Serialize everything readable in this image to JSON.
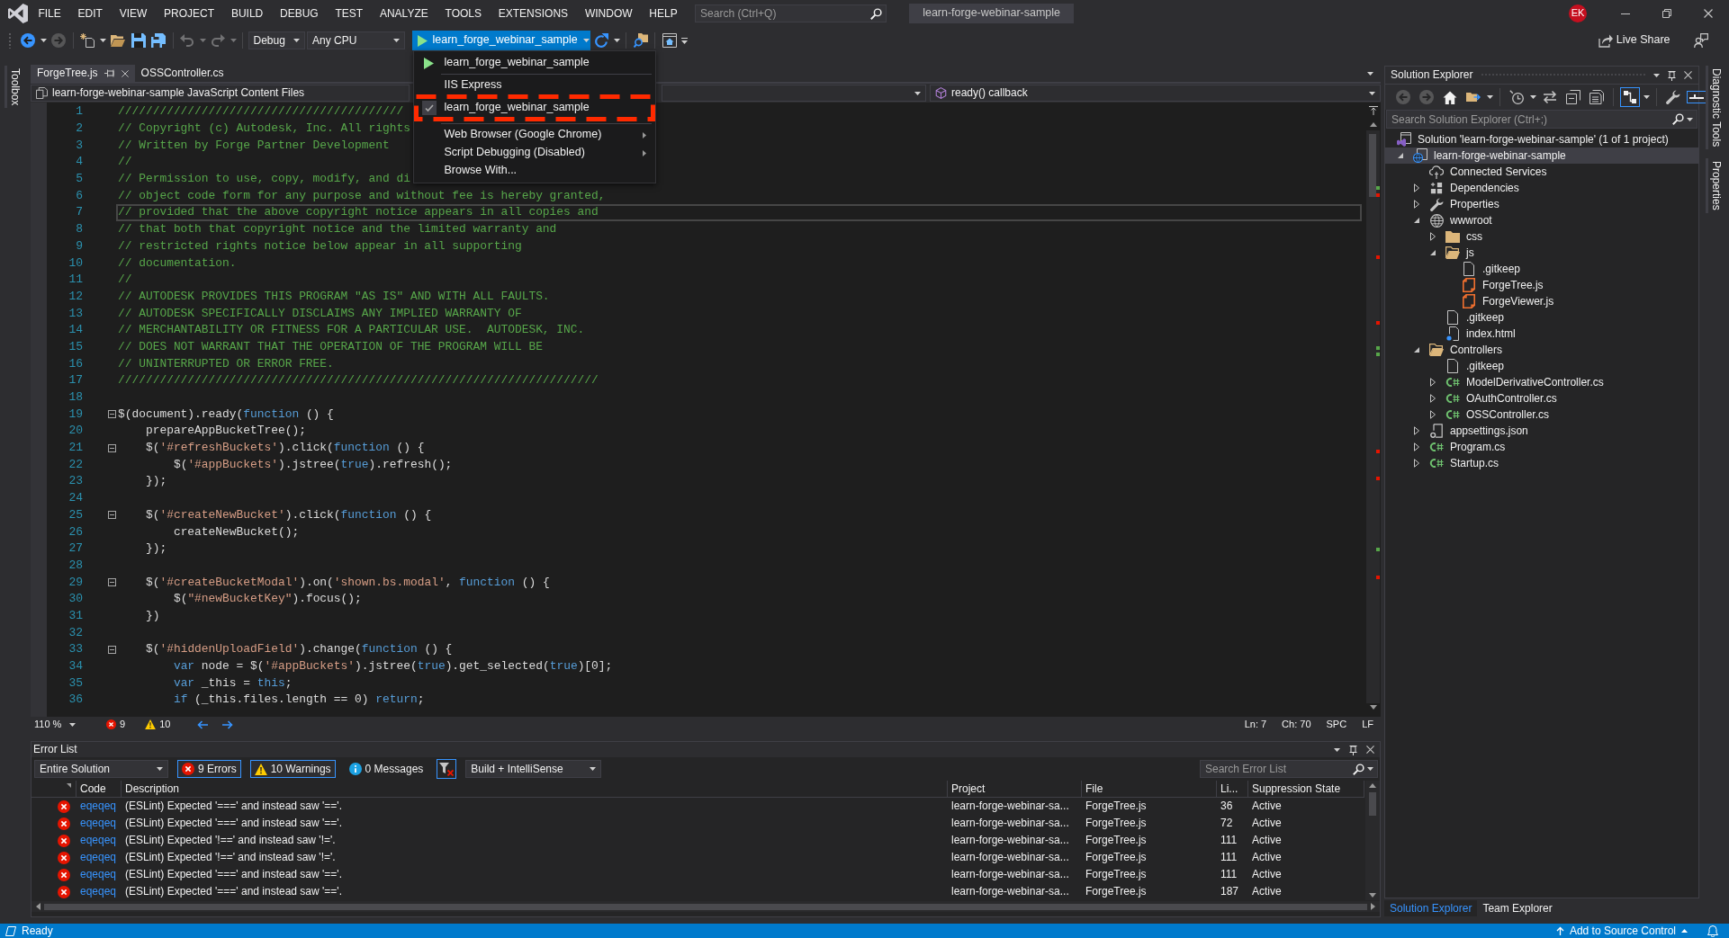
{
  "title_bar": {
    "menu": [
      "FILE",
      "EDIT",
      "VIEW",
      "PROJECT",
      "BUILD",
      "DEBUG",
      "TEST",
      "ANALYZE",
      "TOOLS",
      "EXTENSIONS",
      "WINDOW",
      "HELP"
    ],
    "search": {
      "placeholder": "Search (Ctrl+Q)"
    },
    "solution_name": "learn-forge-webinar-sample",
    "avatar": "EK"
  },
  "toolbar": {
    "items": [
      {
        "kind": "back",
        "disabled": false
      },
      {
        "kind": "caret",
        "disabled": false
      },
      {
        "kind": "forward",
        "disabled": true
      },
      {
        "kind": "separator"
      },
      {
        "kind": "new-project",
        "disabled": false
      },
      {
        "kind": "caret",
        "disabled": false
      },
      {
        "kind": "open",
        "disabled": false
      },
      {
        "kind": "save",
        "disabled": false
      },
      {
        "kind": "save-all",
        "disabled": false
      },
      {
        "kind": "separator"
      },
      {
        "kind": "undo",
        "disabled": true
      },
      {
        "kind": "caret",
        "disabled": true
      },
      {
        "kind": "redo",
        "disabled": true
      },
      {
        "kind": "caret",
        "disabled": true
      },
      {
        "kind": "separator"
      },
      {
        "kind": "combo",
        "value": "Debug"
      },
      {
        "kind": "combo",
        "value": "Any CPU"
      },
      {
        "kind": "run",
        "label": "learn_forge_webinar_sample",
        "expanded": true,
        "menu": [
          {
            "items": [
              {
                "kind": "run",
                "label": "learn_forge_webinar_sample",
                "checked": false,
                "annotated": false
              }
            ]
          },
          {
            "items": [
              {
                "kind": "option",
                "label": "IIS Express",
                "checked": false,
                "annotated": false
              },
              {
                "kind": "option",
                "label": "learn_forge_webinar_sample",
                "checked": true,
                "annotated": true
              }
            ]
          },
          {
            "items": [
              {
                "kind": "submenu",
                "label": "Web Browser (Google Chrome)",
                "checked": false,
                "annotated": false
              },
              {
                "kind": "submenu",
                "label": "Script Debugging (Disabled)",
                "checked": false,
                "annotated": false
              },
              {
                "kind": "command",
                "label": "Browse With...",
                "checked": false,
                "annotated": false
              }
            ]
          }
        ]
      },
      {
        "kind": "refresh",
        "disabled": false
      },
      {
        "kind": "caret",
        "disabled": false
      },
      {
        "kind": "separator"
      },
      {
        "kind": "find",
        "disabled": false
      },
      {
        "kind": "separator"
      },
      {
        "kind": "browser-link",
        "disabled": false
      },
      {
        "kind": "overflow",
        "disabled": false
      }
    ],
    "live_share": "Live Share"
  },
  "toolbox": "Toolbox",
  "editor": {
    "tabs": [
      {
        "label": "ForgeTree.js",
        "selected": true
      },
      {
        "label": "OSSController.cs",
        "selected": false
      }
    ],
    "navigation": {
      "project": "learn-forge-webinar-sample JavaScript Content Files",
      "member": "ready() callback"
    },
    "lines": [
      {
        "number": "1",
        "fold": false,
        "current": false,
        "tokens": [
          {
            "kind": "comment",
            "text": "/////////////////////////////////////////"
          }
        ]
      },
      {
        "number": "2",
        "fold": false,
        "current": false,
        "tokens": [
          {
            "kind": "comment",
            "text": "// Copyright (c) Autodesk, Inc. All rights"
          }
        ]
      },
      {
        "number": "3",
        "fold": false,
        "current": false,
        "tokens": [
          {
            "kind": "comment",
            "text": "// Written by Forge Partner Development"
          }
        ]
      },
      {
        "number": "4",
        "fold": false,
        "current": false,
        "tokens": [
          {
            "kind": "comment",
            "text": "//"
          }
        ]
      },
      {
        "number": "5",
        "fold": false,
        "current": false,
        "tokens": [
          {
            "kind": "comment",
            "text": "// Permission to use, copy, modify, and di"
          }
        ]
      },
      {
        "number": "6",
        "fold": false,
        "current": false,
        "tokens": [
          {
            "kind": "comment",
            "text": "// object code form for any purpose and without fee is hereby granted,"
          }
        ]
      },
      {
        "number": "7",
        "fold": false,
        "current": true,
        "tokens": [
          {
            "kind": "comment",
            "text": "// provided that the above copyright notice appears in all copies and"
          }
        ]
      },
      {
        "number": "8",
        "fold": false,
        "current": false,
        "tokens": [
          {
            "kind": "comment",
            "text": "// that both that copyright notice and the limited warranty and"
          }
        ]
      },
      {
        "number": "9",
        "fold": false,
        "current": false,
        "tokens": [
          {
            "kind": "comment",
            "text": "// restricted rights notice below appear in all supporting"
          }
        ]
      },
      {
        "number": "10",
        "fold": false,
        "current": false,
        "tokens": [
          {
            "kind": "comment",
            "text": "// documentation."
          }
        ]
      },
      {
        "number": "11",
        "fold": false,
        "current": false,
        "tokens": [
          {
            "kind": "comment",
            "text": "//"
          }
        ]
      },
      {
        "number": "12",
        "fold": false,
        "current": false,
        "tokens": [
          {
            "kind": "comment",
            "text": "// AUTODESK PROVIDES THIS PROGRAM \"AS IS\" AND WITH ALL FAULTS."
          }
        ]
      },
      {
        "number": "13",
        "fold": false,
        "current": false,
        "tokens": [
          {
            "kind": "comment",
            "text": "// AUTODESK SPECIFICALLY DISCLAIMS ANY IMPLIED WARRANTY OF"
          }
        ]
      },
      {
        "number": "14",
        "fold": false,
        "current": false,
        "tokens": [
          {
            "kind": "comment",
            "text": "// MERCHANTABILITY OR FITNESS FOR A PARTICULAR USE.  AUTODESK, INC."
          }
        ]
      },
      {
        "number": "15",
        "fold": false,
        "current": false,
        "tokens": [
          {
            "kind": "comment",
            "text": "// DOES NOT WARRANT THAT THE OPERATION OF THE PROGRAM WILL BE"
          }
        ]
      },
      {
        "number": "16",
        "fold": false,
        "current": false,
        "tokens": [
          {
            "kind": "comment",
            "text": "// UNINTERRUPTED OR ERROR FREE."
          }
        ]
      },
      {
        "number": "17",
        "fold": false,
        "current": false,
        "tokens": [
          {
            "kind": "comment",
            "text": "/////////////////////////////////////////////////////////////////////"
          }
        ]
      },
      {
        "number": "18",
        "fold": false,
        "current": false
      },
      {
        "number": "19",
        "fold": true,
        "current": false,
        "tokens": [
          {
            "kind": "plain",
            "text": "$(document).ready("
          },
          {
            "kind": "keyword",
            "text": "function"
          },
          {
            "kind": "plain",
            "text": " () {"
          }
        ]
      },
      {
        "number": "20",
        "fold": false,
        "current": false,
        "tokens": [
          {
            "kind": "plain",
            "text": "    prepareAppBucketTree();"
          }
        ]
      },
      {
        "number": "21",
        "fold": true,
        "current": false,
        "tokens": [
          {
            "kind": "plain",
            "text": "    $("
          },
          {
            "kind": "string",
            "text": "'#refreshBuckets'"
          },
          {
            "kind": "plain",
            "text": ").click("
          },
          {
            "kind": "keyword",
            "text": "function"
          },
          {
            "kind": "plain",
            "text": " () {"
          }
        ]
      },
      {
        "number": "22",
        "fold": false,
        "current": false,
        "tokens": [
          {
            "kind": "plain",
            "text": "        $("
          },
          {
            "kind": "string",
            "text": "'#appBuckets'"
          },
          {
            "kind": "plain",
            "text": ").jstree("
          },
          {
            "kind": "keyword",
            "text": "true"
          },
          {
            "kind": "plain",
            "text": ").refresh();"
          }
        ]
      },
      {
        "number": "23",
        "fold": false,
        "current": false,
        "tokens": [
          {
            "kind": "plain",
            "text": "    });"
          }
        ]
      },
      {
        "number": "24",
        "fold": false,
        "current": false
      },
      {
        "number": "25",
        "fold": true,
        "current": false,
        "tokens": [
          {
            "kind": "plain",
            "text": "    $("
          },
          {
            "kind": "string",
            "text": "'#createNewBucket'"
          },
          {
            "kind": "plain",
            "text": ").click("
          },
          {
            "kind": "keyword",
            "text": "function"
          },
          {
            "kind": "plain",
            "text": " () {"
          }
        ]
      },
      {
        "number": "26",
        "fold": false,
        "current": false,
        "tokens": [
          {
            "kind": "plain",
            "text": "        createNewBucket();"
          }
        ]
      },
      {
        "number": "27",
        "fold": false,
        "current": false,
        "tokens": [
          {
            "kind": "plain",
            "text": "    });"
          }
        ]
      },
      {
        "number": "28",
        "fold": false,
        "current": false
      },
      {
        "number": "29",
        "fold": true,
        "current": false,
        "tokens": [
          {
            "kind": "plain",
            "text": "    $("
          },
          {
            "kind": "string",
            "text": "'#createBucketModal'"
          },
          {
            "kind": "plain",
            "text": ").on("
          },
          {
            "kind": "string",
            "text": "'shown.bs.modal'"
          },
          {
            "kind": "plain",
            "text": ", "
          },
          {
            "kind": "keyword",
            "text": "function"
          },
          {
            "kind": "plain",
            "text": " () {"
          }
        ]
      },
      {
        "number": "30",
        "fold": false,
        "current": false,
        "tokens": [
          {
            "kind": "plain",
            "text": "        $("
          },
          {
            "kind": "string",
            "text": "\"#newBucketKey\""
          },
          {
            "kind": "plain",
            "text": ").focus();"
          }
        ]
      },
      {
        "number": "31",
        "fold": false,
        "current": false,
        "tokens": [
          {
            "kind": "plain",
            "text": "    })"
          }
        ]
      },
      {
        "number": "32",
        "fold": false,
        "current": false
      },
      {
        "number": "33",
        "fold": true,
        "current": false,
        "tokens": [
          {
            "kind": "plain",
            "text": "    $("
          },
          {
            "kind": "string",
            "text": "'#hiddenUploadField'"
          },
          {
            "kind": "plain",
            "text": ").change("
          },
          {
            "kind": "keyword",
            "text": "function"
          },
          {
            "kind": "plain",
            "text": " () {"
          }
        ]
      },
      {
        "number": "34",
        "fold": false,
        "current": false,
        "tokens": [
          {
            "kind": "keyword",
            "text": "        var"
          },
          {
            "kind": "plain",
            "text": " node = $("
          },
          {
            "kind": "string",
            "text": "'#appBuckets'"
          },
          {
            "kind": "plain",
            "text": ").jstree("
          },
          {
            "kind": "keyword",
            "text": "true"
          },
          {
            "kind": "plain",
            "text": ").get_selected("
          },
          {
            "kind": "keyword",
            "text": "true"
          },
          {
            "kind": "plain",
            "text": ")[0];"
          }
        ]
      },
      {
        "number": "35",
        "fold": false,
        "current": false,
        "tokens": [
          {
            "kind": "keyword",
            "text": "        var"
          },
          {
            "kind": "plain",
            "text": " _this = "
          },
          {
            "kind": "keyword",
            "text": "this"
          },
          {
            "kind": "plain",
            "text": ";"
          }
        ]
      },
      {
        "number": "36",
        "fold": false,
        "current": false,
        "tokens": [
          {
            "kind": "keyword",
            "text": "        if"
          },
          {
            "kind": "plain",
            "text": " (_this.files.length == 0) "
          },
          {
            "kind": "keyword",
            "text": "return"
          },
          {
            "kind": "plain",
            "text": ";"
          }
        ]
      }
    ],
    "status": {
      "zoom": "110 %",
      "errors": "9",
      "warnings": "10",
      "line": "Ln: 7",
      "column": "Ch: 70",
      "indent": "SPC",
      "line_ending": "LF"
    }
  },
  "error_list": {
    "title": "Error List",
    "scope": "Entire Solution",
    "filters": [
      {
        "kind": "error",
        "label": "9 Errors",
        "selected": true
      },
      {
        "kind": "warning",
        "label": "10 Warnings",
        "selected": true
      },
      {
        "kind": "message",
        "label": "0 Messages",
        "selected": false
      }
    ],
    "filter_button": {
      "selected": true
    },
    "source": "Build + IntelliSense",
    "search": {
      "placeholder": "Search Error List"
    },
    "columns": [
      "Code",
      "Description",
      "Project",
      "File",
      "Li...",
      "Suppression State"
    ],
    "rows": [
      {
        "kind": "error",
        "code": "eqeqeq",
        "description": "(ESLint) Expected '===' and instead saw '=='.",
        "project": "learn-forge-webinar-sa...",
        "file": "ForgeTree.js",
        "line": "36",
        "suppression": "Active"
      },
      {
        "kind": "error",
        "code": "eqeqeq",
        "description": "(ESLint) Expected '===' and instead saw '=='.",
        "project": "learn-forge-webinar-sa...",
        "file": "ForgeTree.js",
        "line": "72",
        "suppression": "Active"
      },
      {
        "kind": "error",
        "code": "eqeqeq",
        "description": "(ESLint) Expected '!==' and instead saw '!='.",
        "project": "learn-forge-webinar-sa...",
        "file": "ForgeTree.js",
        "line": "111",
        "suppression": "Active"
      },
      {
        "kind": "error",
        "code": "eqeqeq",
        "description": "(ESLint) Expected '!==' and instead saw '!='.",
        "project": "learn-forge-webinar-sa...",
        "file": "ForgeTree.js",
        "line": "111",
        "suppression": "Active"
      },
      {
        "kind": "error",
        "code": "eqeqeq",
        "description": "(ESLint) Expected '===' and instead saw '=='.",
        "project": "learn-forge-webinar-sa...",
        "file": "ForgeTree.js",
        "line": "111",
        "suppression": "Active"
      },
      {
        "kind": "error",
        "code": "eqeqeq",
        "description": "(ESLint) Expected '===' and instead saw '=='.",
        "project": "learn-forge-webinar-sa...",
        "file": "ForgeTree.js",
        "line": "187",
        "suppression": "Active"
      }
    ]
  },
  "solution_explorer": {
    "title": "Solution Explorer",
    "toolbar": [
      {
        "kind": "back",
        "disabled": true,
        "selected": false
      },
      {
        "kind": "forward",
        "disabled": true,
        "selected": false
      },
      {
        "kind": "home",
        "disabled": false,
        "selected": false
      },
      {
        "kind": "sync",
        "disabled": false,
        "selected": false
      },
      {
        "kind": "caret",
        "disabled": false,
        "selected": false
      },
      {
        "kind": "separator"
      },
      {
        "kind": "pending",
        "disabled": false,
        "selected": false
      },
      {
        "kind": "caret",
        "disabled": false,
        "selected": false
      },
      {
        "kind": "sync-arrows",
        "disabled": false,
        "selected": false
      },
      {
        "kind": "collapse",
        "disabled": false,
        "selected": false
      },
      {
        "kind": "show-all",
        "disabled": false,
        "selected": false
      },
      {
        "kind": "separator"
      },
      {
        "kind": "toggle-view",
        "disabled": false,
        "selected": true
      },
      {
        "kind": "caret",
        "disabled": false,
        "selected": false
      },
      {
        "kind": "separator"
      },
      {
        "kind": "properties",
        "disabled": false,
        "selected": false
      },
      {
        "kind": "preview",
        "disabled": false,
        "selected": true
      }
    ],
    "search": {
      "placeholder": "Search Solution Explorer (Ctrl+;)"
    },
    "tree": [
      {
        "label": "Solution 'learn-forge-webinar-sample' (1 of 1 project)",
        "kind": "solution",
        "selected": false,
        "children": [
          {
            "label": "learn-forge-webinar-sample",
            "kind": "web-project",
            "selected": true,
            "expanded": true,
            "children": [
              {
                "label": "Connected Services",
                "kind": "connected-services",
                "selected": false
              },
              {
                "label": "Dependencies",
                "kind": "dependencies",
                "selected": false,
                "expanded": false
              },
              {
                "label": "Properties",
                "kind": "properties",
                "selected": false,
                "expanded": false
              },
              {
                "label": "wwwroot",
                "kind": "globe",
                "selected": false,
                "expanded": true,
                "children": [
                  {
                    "label": "css",
                    "kind": "folder",
                    "selected": false,
                    "expanded": false
                  },
                  {
                    "label": "js",
                    "kind": "folder",
                    "selected": false,
                    "expanded": true,
                    "children": [
                      {
                        "label": ".gitkeep",
                        "kind": "file",
                        "selected": false
                      },
                      {
                        "label": "ForgeTree.js",
                        "kind": "js",
                        "selected": false
                      },
                      {
                        "label": "ForgeViewer.js",
                        "kind": "js",
                        "selected": false
                      }
                    ]
                  },
                  {
                    "label": ".gitkeep",
                    "kind": "file",
                    "selected": false
                  },
                  {
                    "label": "index.html",
                    "kind": "html",
                    "selected": false
                  }
                ]
              },
              {
                "label": "Controllers",
                "kind": "folder",
                "selected": false,
                "expanded": true,
                "children": [
                  {
                    "label": ".gitkeep",
                    "kind": "file",
                    "selected": false
                  },
                  {
                    "label": "ModelDerivativeController.cs",
                    "kind": "cs",
                    "selected": false,
                    "expanded": false
                  },
                  {
                    "label": "OAuthController.cs",
                    "kind": "cs",
                    "selected": false,
                    "expanded": false
                  },
                  {
                    "label": "OSSController.cs",
                    "kind": "cs",
                    "selected": false,
                    "expanded": false
                  }
                ]
              },
              {
                "label": "appsettings.json",
                "kind": "json",
                "selected": false,
                "expanded": false
              },
              {
                "label": "Program.cs",
                "kind": "cs",
                "selected": false,
                "expanded": false
              },
              {
                "label": "Startup.cs",
                "kind": "cs",
                "selected": false,
                "expanded": false
              }
            ]
          }
        ]
      }
    ],
    "tabs": [
      {
        "label": "Solution Explorer",
        "selected": true
      },
      {
        "label": "Team Explorer",
        "selected": false
      }
    ]
  },
  "side_tabs": [
    "Diagnostic Tools",
    "Properties"
  ],
  "status_bar": {
    "message": "Ready",
    "source_control": "Add to Source Control"
  }
}
